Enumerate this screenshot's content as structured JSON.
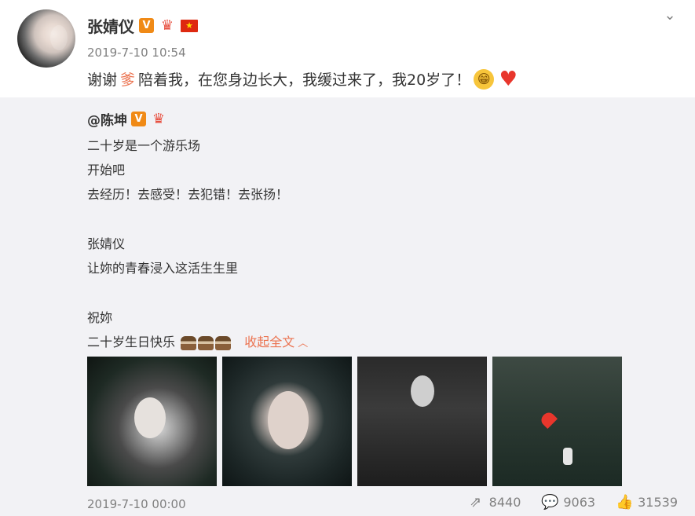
{
  "post": {
    "author_name": "张婧仪",
    "badges": [
      "V",
      "crown",
      "china-flag"
    ],
    "time": "2019-7-10 10:54",
    "text_before": "谢谢",
    "text_highlight": "爹",
    "text_after": "陪着我，在您身边长大，我缓过来了，我20岁了！",
    "emoji": [
      "grin-emoji",
      "heart-emoji"
    ]
  },
  "repost": {
    "author_name": "@陈坤",
    "lines": [
      "二十岁是一个游乐场",
      "开始吧",
      "去经历！去感受！去犯错！去张扬！",
      "张婧仪",
      "让妳的青春浸入这活生生里",
      "祝妳",
      "二十岁生日快乐"
    ],
    "collapse_label": "收起全文",
    "time": "2019-7-10 00:00",
    "photos": [
      "photo-bubbles-girl",
      "photo-portrait",
      "photo-girl-jacket",
      "photo-tree-heart"
    ],
    "stats": {
      "repost_count": "8440",
      "comment_count": "9063",
      "like_count": "31539"
    }
  },
  "colors": {
    "accent": "#eb7350",
    "badge_v": "#f08a16",
    "repost_bg": "#f2f2f5",
    "muted": "#808080"
  }
}
